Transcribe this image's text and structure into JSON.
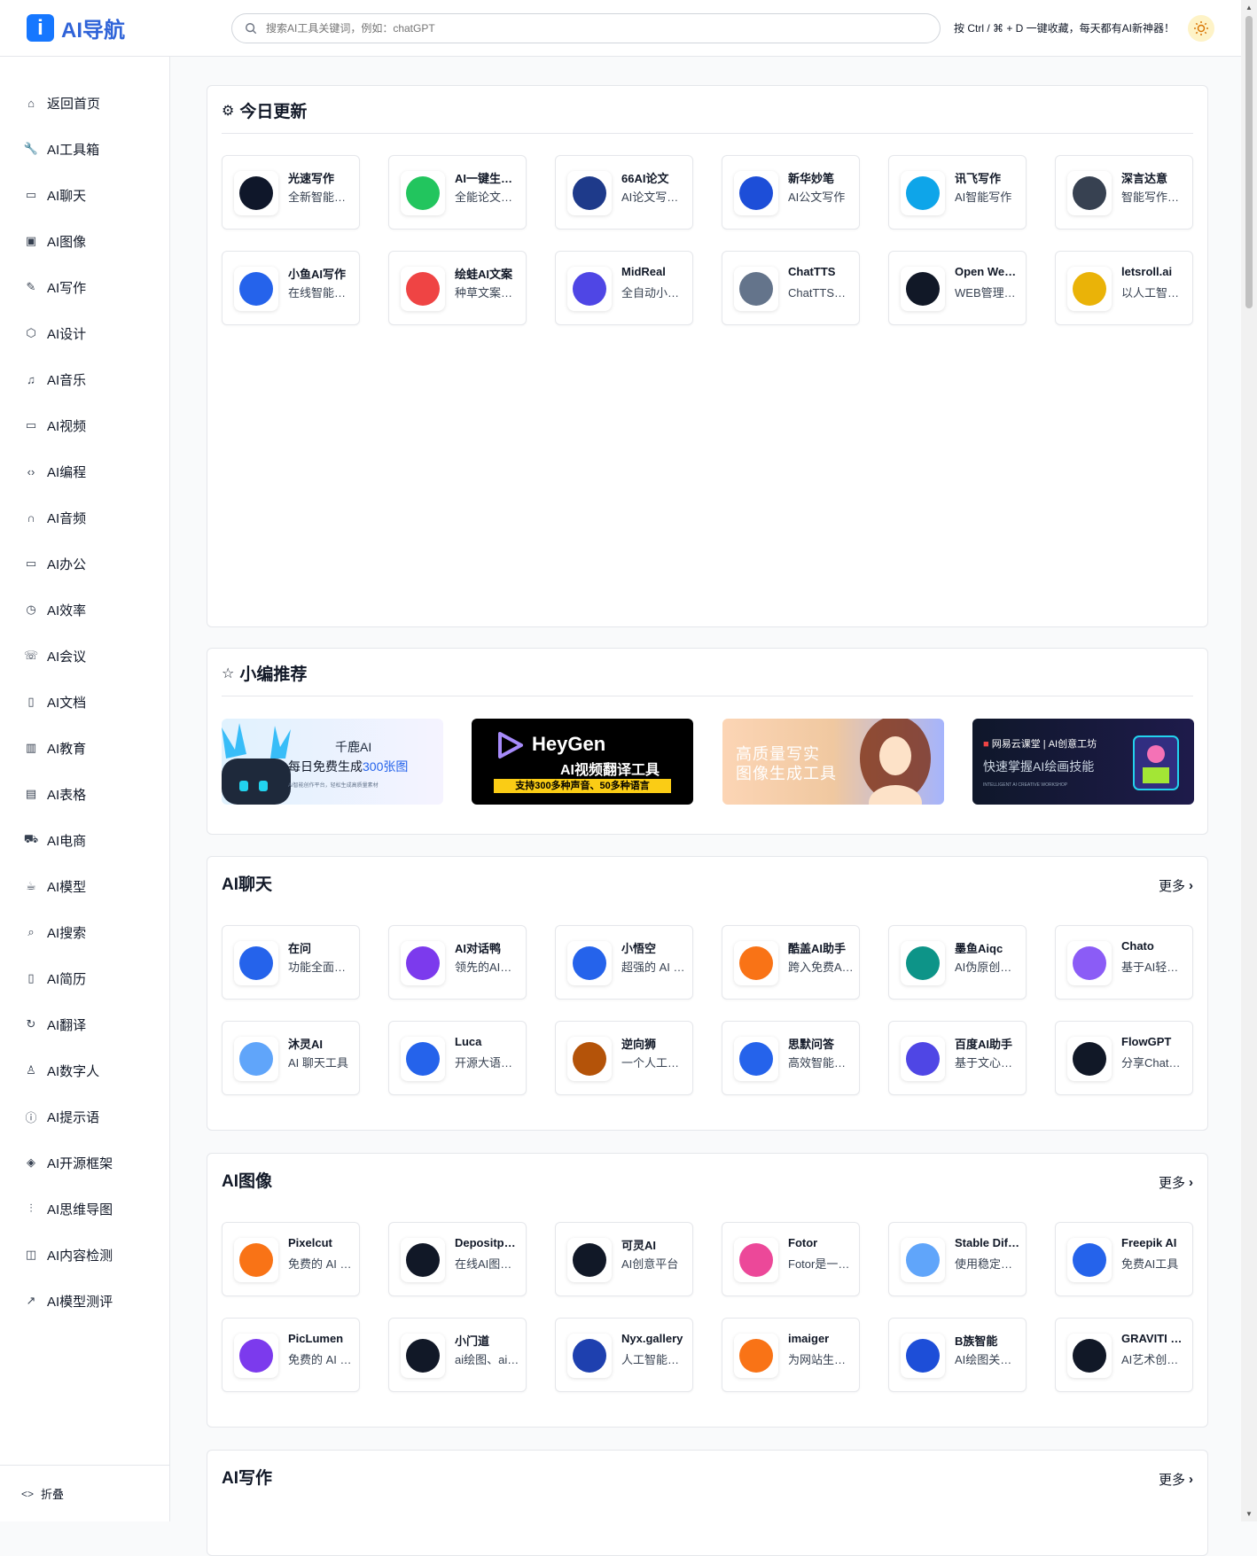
{
  "header": {
    "logo_mark": "i",
    "logo_text": "AI导航",
    "search_placeholder": "搜索AI工具关键词，例如：chatGPT",
    "hint": "按 Ctrl / ⌘ + D 一键收藏，每天都有AI新神器！"
  },
  "sidebar": {
    "items": [
      {
        "label": "返回首页",
        "icon": "home-icon"
      },
      {
        "label": "AI工具箱",
        "icon": "wrench-icon"
      },
      {
        "label": "AI聊天",
        "icon": "chat-icon"
      },
      {
        "label": "AI图像",
        "icon": "image-icon"
      },
      {
        "label": "AI写作",
        "icon": "edit-icon"
      },
      {
        "label": "AI设计",
        "icon": "cube-icon"
      },
      {
        "label": "AI音乐",
        "icon": "music-icon"
      },
      {
        "label": "AI视频",
        "icon": "video-icon"
      },
      {
        "label": "AI编程",
        "icon": "code-icon"
      },
      {
        "label": "AI音频",
        "icon": "headphones-icon"
      },
      {
        "label": "AI办公",
        "icon": "monitor-icon"
      },
      {
        "label": "AI效率",
        "icon": "clock-icon"
      },
      {
        "label": "AI会议",
        "icon": "phone-icon"
      },
      {
        "label": "AI文档",
        "icon": "book-icon"
      },
      {
        "label": "AI教育",
        "icon": "open-book-icon"
      },
      {
        "label": "AI表格",
        "icon": "table-icon"
      },
      {
        "label": "AI电商",
        "icon": "cart-icon"
      },
      {
        "label": "AI模型",
        "icon": "cup-icon"
      },
      {
        "label": "AI搜索",
        "icon": "search-icon"
      },
      {
        "label": "AI简历",
        "icon": "document-icon"
      },
      {
        "label": "AI翻译",
        "icon": "refresh-icon"
      },
      {
        "label": "AI数字人",
        "icon": "user-icon"
      },
      {
        "label": "AI提示语",
        "icon": "info-icon"
      },
      {
        "label": "AI开源框架",
        "icon": "layers-icon"
      },
      {
        "label": "AI思维导图",
        "icon": "sliders-icon"
      },
      {
        "label": "AI内容检测",
        "icon": "columns-icon"
      },
      {
        "label": "AI模型测评",
        "icon": "trend-icon"
      }
    ],
    "collapse_label": "折叠"
  },
  "sections": {
    "today": {
      "title": "今日更新",
      "cards": [
        {
          "name": "光速写作",
          "desc": "全新智能写作工具",
          "color": "#0f172a"
        },
        {
          "name": "AI一键生成论文",
          "desc": "全能论文写作",
          "color": "#22c55e"
        },
        {
          "name": "66AI论文",
          "desc": "AI论文写作工具",
          "color": "#1e3a8a"
        },
        {
          "name": "新华妙笔",
          "desc": "AI公文写作",
          "color": "#1d4ed8"
        },
        {
          "name": "讯飞写作",
          "desc": "AI智能写作",
          "color": "#0ea5e9"
        },
        {
          "name": "深言达意",
          "desc": "智能写作助手",
          "color": "#374151"
        },
        {
          "name": "小鱼AI写作",
          "desc": "在线智能写作",
          "color": "#2563eb"
        },
        {
          "name": "绘蛙AI文案",
          "desc": "种草文案生成",
          "color": "#ef4444"
        },
        {
          "name": "MidReal",
          "desc": "全自动小说生成",
          "color": "#4f46e5"
        },
        {
          "name": "ChatTTS",
          "desc": "ChatTTS语音合成",
          "color": "#64748b"
        },
        {
          "name": "Open WebUI",
          "desc": "WEB管理界面",
          "color": "#111827"
        },
        {
          "name": "letsroll.ai",
          "desc": "以人工智能生成",
          "color": "#eab308"
        }
      ]
    },
    "recommend": {
      "title": "小编推荐",
      "banners": [
        {
          "line1": "千鹿AI",
          "line2": "每日免费生成",
          "highlight": "300张图",
          "note": "AI智能创作平台，轻松生成高质量素材",
          "bg": "#e0f2fe"
        },
        {
          "line1": "HeyGen",
          "line2": "AI视频翻译工具",
          "highlight": "支持300多种声音、50多种语言",
          "note": "",
          "bg": "#000000"
        },
        {
          "line1": "高质量写实",
          "line2": "图像生成工具",
          "highlight": "",
          "note": "",
          "bg": "#f5d0b5"
        },
        {
          "line1": "网易云课堂 | AI创意工坊",
          "line2": "快速掌握AI绘画技能",
          "highlight": "",
          "note": "INTELLIGENT AI CREATIVE WORKSHOP",
          "bg": "#111827"
        }
      ]
    },
    "chat": {
      "title": "AI聊天",
      "more": "更多",
      "cards": [
        {
          "name": "在问",
          "desc": "功能全面的AI助手",
          "color": "#2563eb"
        },
        {
          "name": "AI对话鸭",
          "desc": "领先的AI对话工具",
          "color": "#7c3aed"
        },
        {
          "name": "小悟空",
          "desc": "超强的 AI 助手",
          "color": "#2563eb"
        },
        {
          "name": "酷盖AI助手",
          "desc": "跨入免费AI时代",
          "color": "#f97316"
        },
        {
          "name": "墨鱼Aiqc",
          "desc": "AI伪原创工具",
          "color": "#0d9488"
        },
        {
          "name": "Chato",
          "desc": "基于AI轻松定制",
          "color": "#8b5cf6"
        },
        {
          "name": "沐灵AI",
          "desc": "AI 聊天工具",
          "color": "#60a5fa"
        },
        {
          "name": "Luca",
          "desc": "开源大语言模型",
          "color": "#2563eb"
        },
        {
          "name": "逆向狮",
          "desc": "一个人工智能助手",
          "color": "#b45309"
        },
        {
          "name": "思默问答",
          "desc": "高效智能问答",
          "color": "#2563eb"
        },
        {
          "name": "百度AI助手",
          "desc": "基于文心大模型",
          "color": "#4f46e5"
        },
        {
          "name": "FlowGPT",
          "desc": "分享ChatGPT提示",
          "color": "#111827"
        }
      ]
    },
    "image": {
      "title": "AI图像",
      "more": "更多",
      "cards": [
        {
          "name": "Pixelcut",
          "desc": "免费的 AI 图片编辑",
          "color": "#f97316"
        },
        {
          "name": "Depositphotos",
          "desc": "在线AI图片编辑",
          "color": "#111827"
        },
        {
          "name": "可灵AI",
          "desc": "AI创意平台",
          "color": "#111827"
        },
        {
          "name": "Fotor",
          "desc": "Fotor是一款图片编辑",
          "color": "#ec4899"
        },
        {
          "name": "Stable Diffusion",
          "desc": "使用稳定扩散模型",
          "color": "#60a5fa"
        },
        {
          "name": "Freepik AI",
          "desc": "免费AI工具",
          "color": "#2563eb"
        },
        {
          "name": "PicLumen",
          "desc": "免费的 AI 图像生成",
          "color": "#7c3aed"
        },
        {
          "name": "小门道",
          "desc": "ai绘图、ai设计",
          "color": "#111827"
        },
        {
          "name": "Nyx.gallery",
          "desc": "人工智能图像生成",
          "color": "#1e40af"
        },
        {
          "name": "imaiger",
          "desc": "为网站生成图像",
          "color": "#f97316"
        },
        {
          "name": "B族智能",
          "desc": "AI绘图关键词",
          "color": "#1d4ed8"
        },
        {
          "name": "GRAVITI Diffus",
          "desc": "AI艺术创作平台",
          "color": "#111827"
        }
      ]
    },
    "writing": {
      "title": "AI写作",
      "more": "更多"
    }
  },
  "colors": {
    "accent": "#1677ff",
    "logo_text": "#2f63d8",
    "border": "#e5e7eb",
    "background": "#f9fafb"
  }
}
